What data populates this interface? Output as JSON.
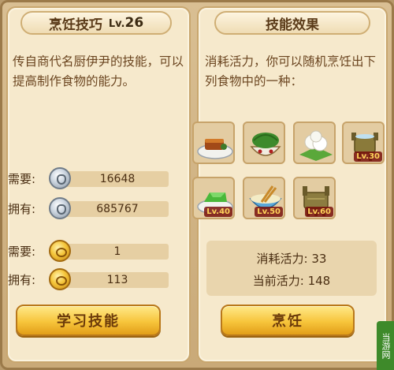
{
  "left_panel": {
    "title": "烹饪技巧",
    "level_prefix": "Lv.",
    "level": "26",
    "description": "传自商代名厨伊尹的技能，可以提高制作食物的能力。",
    "rows": [
      {
        "label": "需要:",
        "icon": "silver-coin-icon",
        "value": "16648"
      },
      {
        "label": "拥有:",
        "icon": "silver-coin-icon",
        "value": "685767"
      },
      {
        "label": "需要:",
        "icon": "gold-coin-icon",
        "value": "1"
      },
      {
        "label": "拥有:",
        "icon": "gold-coin-icon",
        "value": "113"
      }
    ],
    "learn_button": "学习技能"
  },
  "right_panel": {
    "title": "技能效果",
    "description": "消耗活力，你可以随机烹饪出下列食物中的一种：",
    "foods": [
      {
        "icon": "braised-meat-icon",
        "level": ""
      },
      {
        "icon": "rice-dumpling-bowl-icon",
        "level": ""
      },
      {
        "icon": "steamed-bun-leaf-icon",
        "level": ""
      },
      {
        "icon": "bronze-cauldron-icon",
        "level": "Lv.30"
      },
      {
        "icon": "green-jelly-icon",
        "level": "Lv.40"
      },
      {
        "icon": "porridge-bowl-icon",
        "level": "Lv.50"
      },
      {
        "icon": "bronze-ding-icon",
        "level": "Lv.60"
      }
    ],
    "cost_label": "消耗活力:",
    "cost_value": "33",
    "current_label": "当前活力:",
    "current_value": "148",
    "cook_button": "烹饪"
  },
  "watermark": "当游网",
  "colors": {
    "panel_bg": "#f6e9cc",
    "text_brown": "#6b4520",
    "button_gold": "#f7c53c",
    "level_tag_red": "#78100c"
  }
}
